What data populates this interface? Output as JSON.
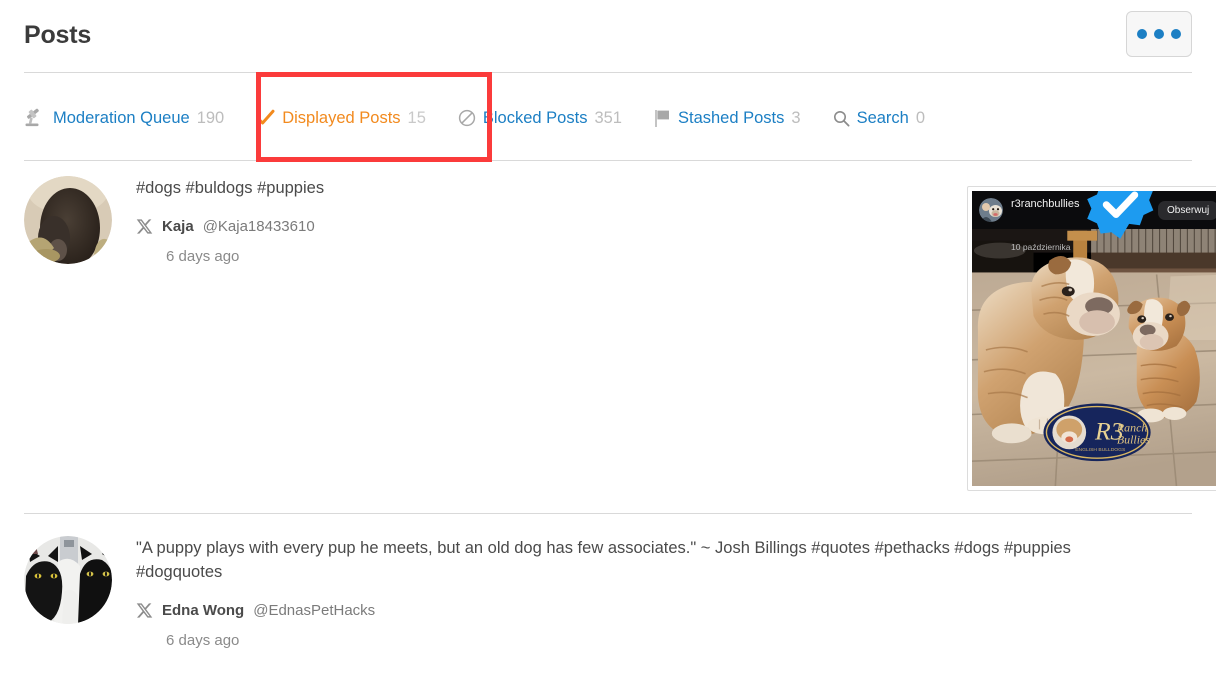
{
  "header": {
    "title": "Posts",
    "more_button": {
      "icon": "more-horizontal-icon",
      "dots": 3
    }
  },
  "tabs": [
    {
      "id": "moderation-queue",
      "icon": "gavel-icon",
      "label": "Moderation Queue",
      "count": "190",
      "active": false
    },
    {
      "id": "displayed-posts",
      "icon": "check-icon",
      "label": "Displayed Posts",
      "count": "15",
      "active": true
    },
    {
      "id": "blocked-posts",
      "icon": "blocked-icon",
      "label": "Blocked Posts",
      "count": "351",
      "active": false
    },
    {
      "id": "stashed-posts",
      "icon": "flag-icon",
      "label": "Stashed Posts",
      "count": "3",
      "active": false
    },
    {
      "id": "search",
      "icon": "search-icon",
      "label": "Search",
      "count": "0",
      "active": false
    }
  ],
  "highlight": {
    "target": "displayed-posts",
    "color": "#fb3b3b"
  },
  "posts": [
    {
      "id": "post-1",
      "avatar_alt": "dark puppy in straw basket",
      "text": "#dogs #buldogs #puppies",
      "network_icon": "x-logo-icon",
      "author_name": "Kaja",
      "author_handle": "@Kaja18433610",
      "time": "6 days ago",
      "media": {
        "type": "instagram-embed",
        "username": "r3ranchbullies",
        "verified": true,
        "date": "10 października",
        "follow_label": "Obserwuj",
        "menu_icon": "kebab-menu-icon",
        "alt": "adult english bulldog facing a bulldog puppy on a stone patio"
      }
    },
    {
      "id": "post-2",
      "avatar_alt": "two black cats",
      "text": "\"A puppy plays with every pup he meets, but an old dog has few associates.\" ~ Josh Billings #quotes #pethacks #dogs #puppies #dogquotes",
      "network_icon": "x-logo-icon",
      "author_name": "Edna Wong",
      "author_handle": "@EdnasPetHacks",
      "time": "6 days ago",
      "media": null
    }
  ],
  "colors": {
    "link": "#1c7fc4",
    "active_tab": "#f28a1e",
    "count": "#bdbdbd",
    "title": "#3b3b3b",
    "body_text": "#4a4a4a",
    "divider": "#d9d9d9",
    "highlight": "#fb3b3b"
  }
}
